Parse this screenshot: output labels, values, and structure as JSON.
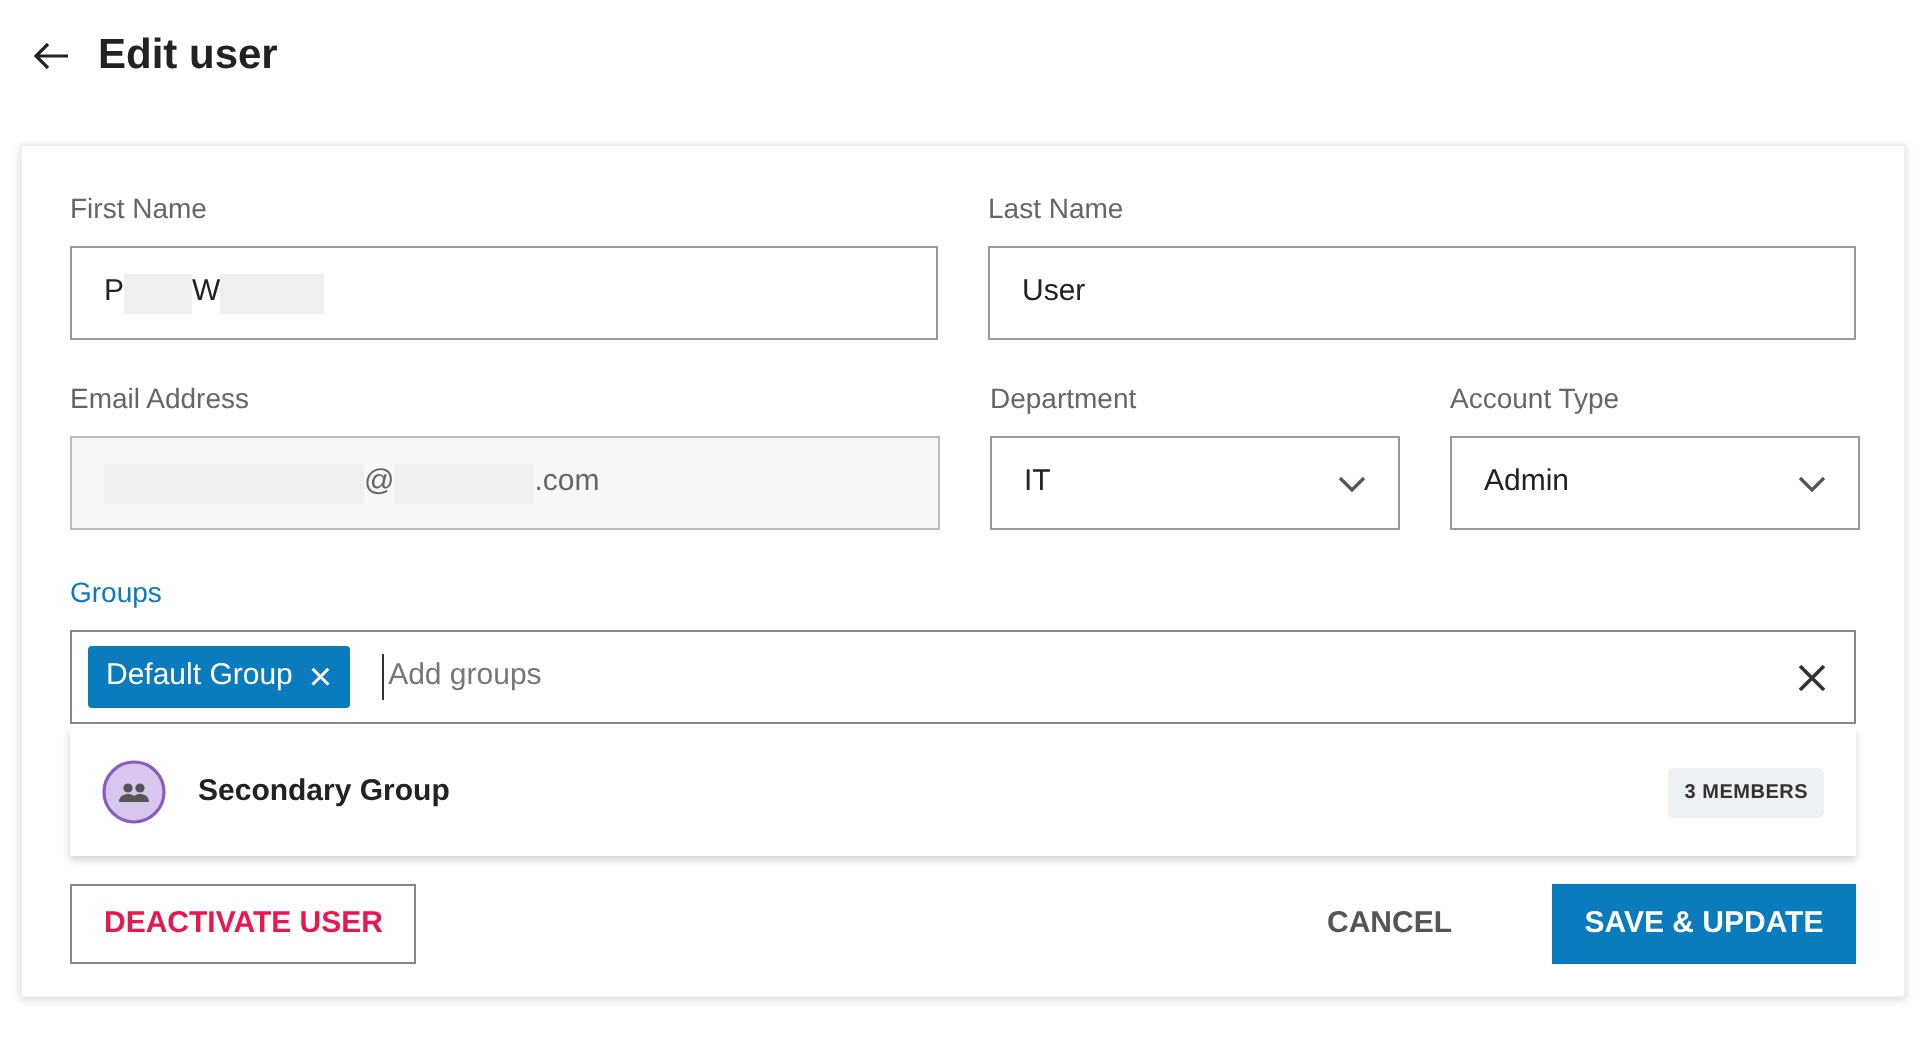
{
  "header": {
    "title": "Edit user"
  },
  "fields": {
    "first_name": {
      "label": "First Name",
      "parts": [
        {
          "kind": "text",
          "text": "P"
        },
        {
          "kind": "redacted"
        },
        {
          "kind": "text",
          "text": "W"
        },
        {
          "kind": "redacted"
        }
      ]
    },
    "last_name": {
      "label": "Last Name",
      "value": "User"
    },
    "email": {
      "label": "Email Address",
      "disabled": true,
      "parts": [
        {
          "kind": "redacted"
        },
        {
          "kind": "text",
          "text": "@"
        },
        {
          "kind": "redacted"
        },
        {
          "kind": "text",
          "text": ".com"
        }
      ]
    },
    "department": {
      "label": "Department",
      "value": "IT"
    },
    "account_type": {
      "label": "Account Type",
      "value": "Admin"
    }
  },
  "groups": {
    "label": "Groups",
    "chips": [
      {
        "label": "Default Group",
        "remove": "×"
      }
    ],
    "placeholder": "Add groups",
    "suggestions": [
      {
        "name": "Secondary Group",
        "badge": "3 MEMBERS"
      }
    ]
  },
  "actions": {
    "deactivate": "DEACTIVATE USER",
    "cancel": "CANCEL",
    "save": "SAVE & UPDATE"
  }
}
